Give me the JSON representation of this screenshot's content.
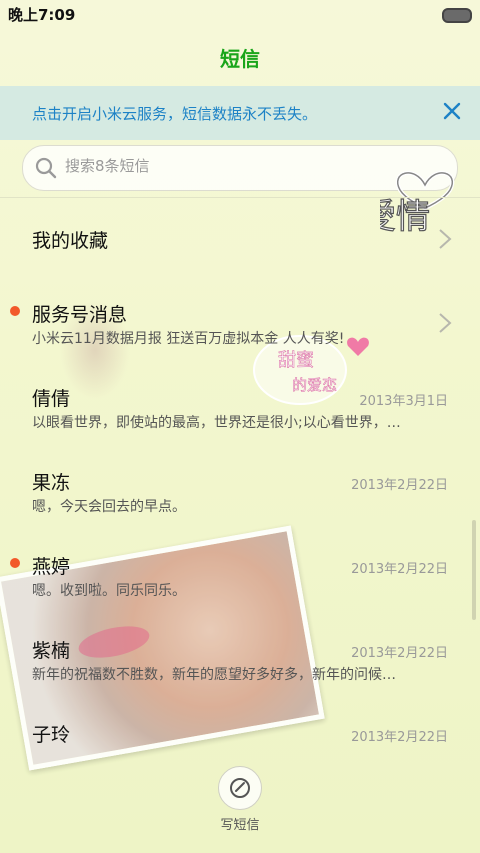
{
  "status": {
    "time": "晚上7:09"
  },
  "header": {
    "title": "短信"
  },
  "banner": {
    "text": "点击开启小米云服务，短信数据永不丢失。"
  },
  "search": {
    "placeholder": "搜索8条短信"
  },
  "decor": {
    "love_text": "愛情",
    "heart_text_1": "甜蜜",
    "heart_text_2": "的爱恋"
  },
  "conversations": [
    {
      "title": "我的收藏",
      "preview": "",
      "date": "",
      "unread": false,
      "chevron": true
    },
    {
      "title": "服务号消息",
      "preview": "小米云11月数据月报 狂送百万虚拟本金 人人有奖!",
      "date": "",
      "unread": true,
      "chevron": true
    },
    {
      "title": "倩倩",
      "preview": "以眼看世界，即使站的最高，世界还是很小;以心看世界，…",
      "date": "2013年3月1日",
      "unread": false,
      "chevron": false
    },
    {
      "title": "果冻",
      "preview": "嗯，今天会回去的早点。",
      "date": "2013年2月22日",
      "unread": false,
      "chevron": false
    },
    {
      "title": "燕婷",
      "preview": "嗯。收到啦。同乐同乐。",
      "date": "2013年2月22日",
      "unread": true,
      "chevron": false
    },
    {
      "title": "紫楠",
      "preview": "新年的祝福数不胜数，新年的愿望好多好多，新年的问候…",
      "date": "2013年2月22日",
      "unread": false,
      "chevron": false
    },
    {
      "title": "子玲",
      "preview": "",
      "date": "2013年2月22日",
      "unread": false,
      "chevron": false
    }
  ],
  "compose": {
    "label": "写短信"
  },
  "colors": {
    "accent": "#1aa51a",
    "banner_text": "#1d82c6",
    "unread": "#f2592a"
  }
}
